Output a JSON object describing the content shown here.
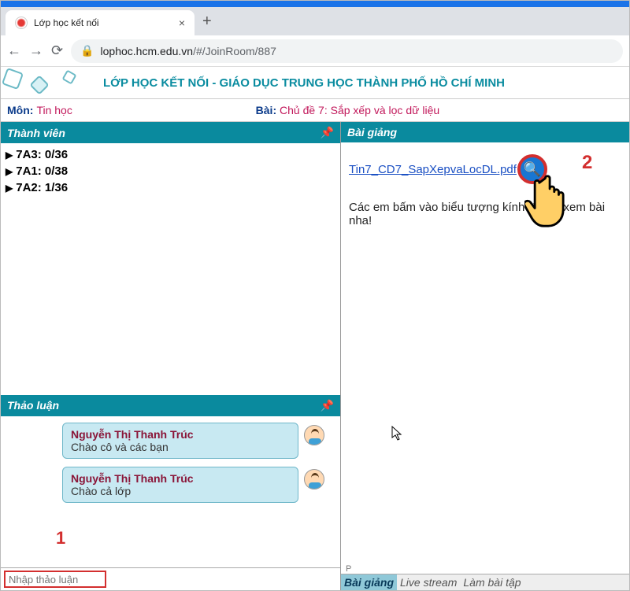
{
  "browser": {
    "tab_title": "Lớp học kết nối",
    "url_host": "lophoc.hcm.edu.vn",
    "url_path": "/#/JoinRoom/887"
  },
  "site": {
    "title": "LỚP HỌC KẾT NỐI  -  GIÁO DỤC TRUNG HỌC THÀNH PHỐ HỒ CHÍ MINH"
  },
  "info": {
    "subject_label": "Môn:",
    "subject_value": "Tin học",
    "lesson_label": "Bài:",
    "lesson_value": "Chủ đề 7: Sắp xếp và lọc dữ liệu"
  },
  "panels": {
    "members_title": "Thành viên",
    "discussion_title": "Thảo luận",
    "lecture_title": "Bài giảng"
  },
  "members": [
    {
      "label": "7A3: 0/36"
    },
    {
      "label": "7A1: 0/38"
    },
    {
      "label": "7A2: 1/36"
    }
  ],
  "chat": [
    {
      "name": "Nguyễn Thị Thanh Trúc",
      "text": "Chào cô và các bạn"
    },
    {
      "name": "Nguyễn Thị Thanh Trúc",
      "text": "Chào cả lớp"
    }
  ],
  "chat_input": {
    "placeholder": "Nhập thảo luận"
  },
  "lecture": {
    "pdf_name": "Tin7_CD7_SapXepvaLocDL.pdf",
    "instruction": "Các em bấm vào biểu tượng kính lúp để xem bài nha!",
    "path_indicator": "P"
  },
  "bottom_tabs": {
    "lecture": "Bài giảng",
    "livestream": "Live stream",
    "exercise": "Làm bài tập"
  },
  "annotations": {
    "one": "1",
    "two": "2"
  }
}
